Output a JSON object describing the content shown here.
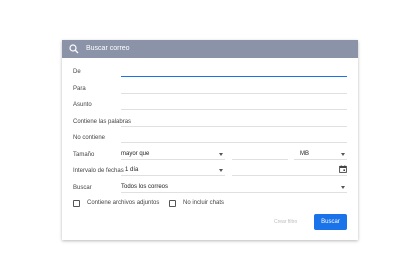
{
  "search": {
    "label": "Buscar correo"
  },
  "fields": {
    "from": "De",
    "to": "Para",
    "subject": "Asunto",
    "has_words": "Contiene las palabras",
    "not_contains": "No contiene",
    "size": "Tamaño",
    "date_range": "Intervalo de fechas",
    "search_in": "Buscar"
  },
  "size": {
    "operator": "mayor que",
    "value": "",
    "unit": "MB"
  },
  "date_range": {
    "value": "1 día",
    "date": ""
  },
  "search_in": {
    "value": "Todos los correos"
  },
  "checkboxes": {
    "has_attachment": "Contiene archivos adjuntos",
    "exclude_chats": "No incluir chats"
  },
  "buttons": {
    "create_filter": "Crear filtro",
    "search": "Buscar"
  },
  "colors": {
    "header": "#8a93a8",
    "accent": "#1a73e8"
  },
  "icons": [
    "search-icon",
    "calendar-icon",
    "chevron-down-icon"
  ]
}
